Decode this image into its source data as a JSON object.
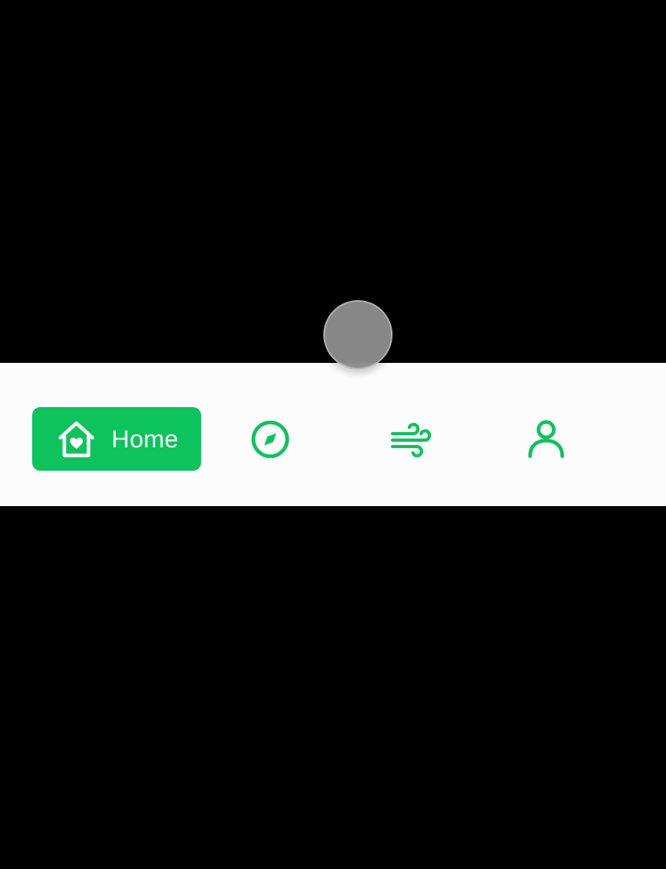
{
  "colors": {
    "accent": "#0cc45b",
    "nav_background": "#fcfcfc",
    "screen_background": "#000000",
    "touch_indicator": "#8c8c8c"
  },
  "bottom_nav": {
    "items": [
      {
        "label": "Home",
        "icon": "home-heart-icon",
        "active": true
      },
      {
        "label": "",
        "icon": "compass-icon",
        "active": false
      },
      {
        "label": "",
        "icon": "wind-icon",
        "active": false
      },
      {
        "label": "",
        "icon": "user-icon",
        "active": false
      }
    ]
  }
}
